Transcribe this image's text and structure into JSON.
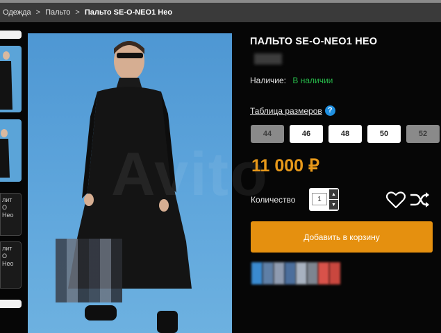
{
  "breadcrumb": {
    "items": [
      "Одежда",
      "Пальто"
    ],
    "current": "Пальто SE-O-NEO1 Нео",
    "separator": ">"
  },
  "thumbs": {
    "thumb3_text": "лит\nO\nНео",
    "thumb4_text": "лит\nO\nНео"
  },
  "product": {
    "title": "ПАЛЬТО SE-O-NEO1 НЕО",
    "availability_label": "Наличие:",
    "availability_value": "В наличии",
    "availability_color": "#27b94a",
    "size_table_label": "Таблица размеров",
    "help_icon_glyph": "?",
    "sizes": [
      {
        "label": "44",
        "available": false
      },
      {
        "label": "46",
        "available": true
      },
      {
        "label": "48",
        "available": true
      },
      {
        "label": "50",
        "available": true
      },
      {
        "label": "52",
        "available": false
      }
    ],
    "price": "11 000 ₽",
    "price_color": "#e8991a",
    "quantity_label": "Количество",
    "quantity_value": "1",
    "quantity_up": "▲",
    "quantity_down": "▼",
    "add_to_cart_label": "Добавить в корзину",
    "accent_color": "#e5900f"
  },
  "watermark": "Avito",
  "icons": {
    "wishlist": "heart-icon",
    "compare": "shuffle-icon",
    "help": "question-icon"
  }
}
